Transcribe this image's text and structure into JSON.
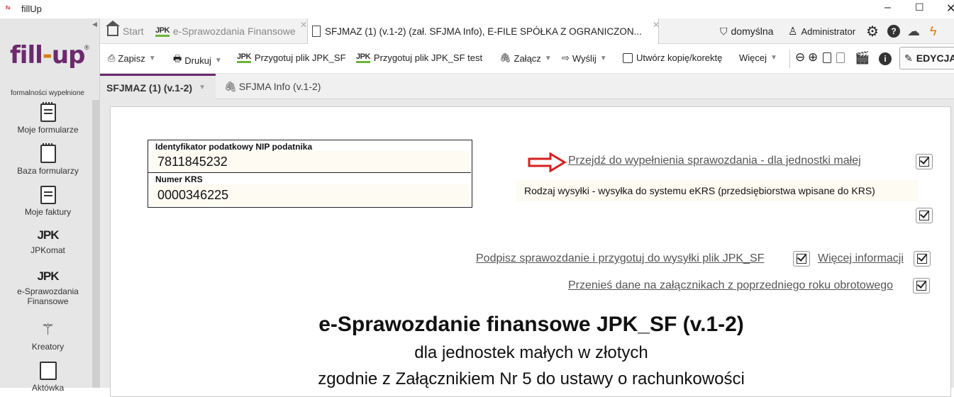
{
  "window": {
    "title": "fillUp",
    "controls": [
      "–",
      "☐",
      "✕"
    ]
  },
  "sidebar": {
    "logo_text_a": "fill",
    "logo_text_dot": "-",
    "logo_text_b": "up",
    "logo_reg": "®",
    "logo_subtitle": "formalności wypełnione",
    "items": [
      {
        "label": "Moje formularze",
        "icon": "notebook-icon"
      },
      {
        "label": "Baza formularzy",
        "icon": "notebook-icon"
      },
      {
        "label": "Moje faktury",
        "icon": "document-icon"
      },
      {
        "label": "JPKomat",
        "icon": "jpk-icon"
      },
      {
        "label": "e-Sprawozdania Finansowe",
        "icon": "jpk-icon"
      },
      {
        "label": "Kreatory",
        "icon": "magic-wand-icon"
      },
      {
        "label": "Aktówka",
        "icon": "id-card-icon"
      }
    ],
    "jpk_glyph": "JPK"
  },
  "tabs": [
    {
      "label": "Start"
    },
    {
      "label": "e-Sprawozdania Finansowe"
    },
    {
      "label": "SFJMAZ (1) (v.1-2) (zał. SFJMA Info), E-FILE SPÓŁKA Z OGRANICZON..."
    }
  ],
  "tabs_right": {
    "profile": "domyślna",
    "user": "Administrator",
    "help_glyph": "?"
  },
  "toolbar": {
    "save": "Zapisz",
    "print": "Drukuj",
    "prepare": "Przygotuj plik JPK_SF",
    "prepare_test": "Przygotuj plik JPK_SF test",
    "attach": "Załącz",
    "send": "Wyślij",
    "copy": "Utwórz kopię/korektę",
    "more": "Więcej",
    "info_glyph": "i",
    "edit_mode": "EDYCJA"
  },
  "subtabs": [
    {
      "label": "SFJMAZ (1) (v.1-2)"
    },
    {
      "label": "SFJMA Info (v.1-2)"
    }
  ],
  "form": {
    "nip_label": "Identyfikator podatkowy NIP podatnika",
    "nip_value": "7811845232",
    "krs_label": "Numer KRS",
    "krs_value": "0000346225",
    "link_fill": "Przejdź do wypełnienia sprawozdania - dla jednostki małej",
    "send_type": "Rodzaj wysyłki - wysyłka do systemu eKRS (przedsiębiorstwa wpisane do KRS)",
    "link_sign": "Podpisz sprawozdanie i przygotuj do wysyłki plik JPK_SF",
    "link_more_info": "Więcej informacji",
    "link_transfer": "Przenieś dane na załącznikach z poprzedniego roku obrotowego",
    "title": "e-Sprawozdanie finansowe JPK_SF (v.1-2)",
    "subtitle": "dla jednostek małych w złotych",
    "subtitle2": "zgodnie z Załącznikiem Nr 5 do ustawy o rachunkowości"
  },
  "colors": {
    "brand_purple": "#6b2a6e",
    "brand_orange": "#e07a10",
    "arrow_red": "#d62020",
    "jpk_green": "#6bb43a"
  }
}
